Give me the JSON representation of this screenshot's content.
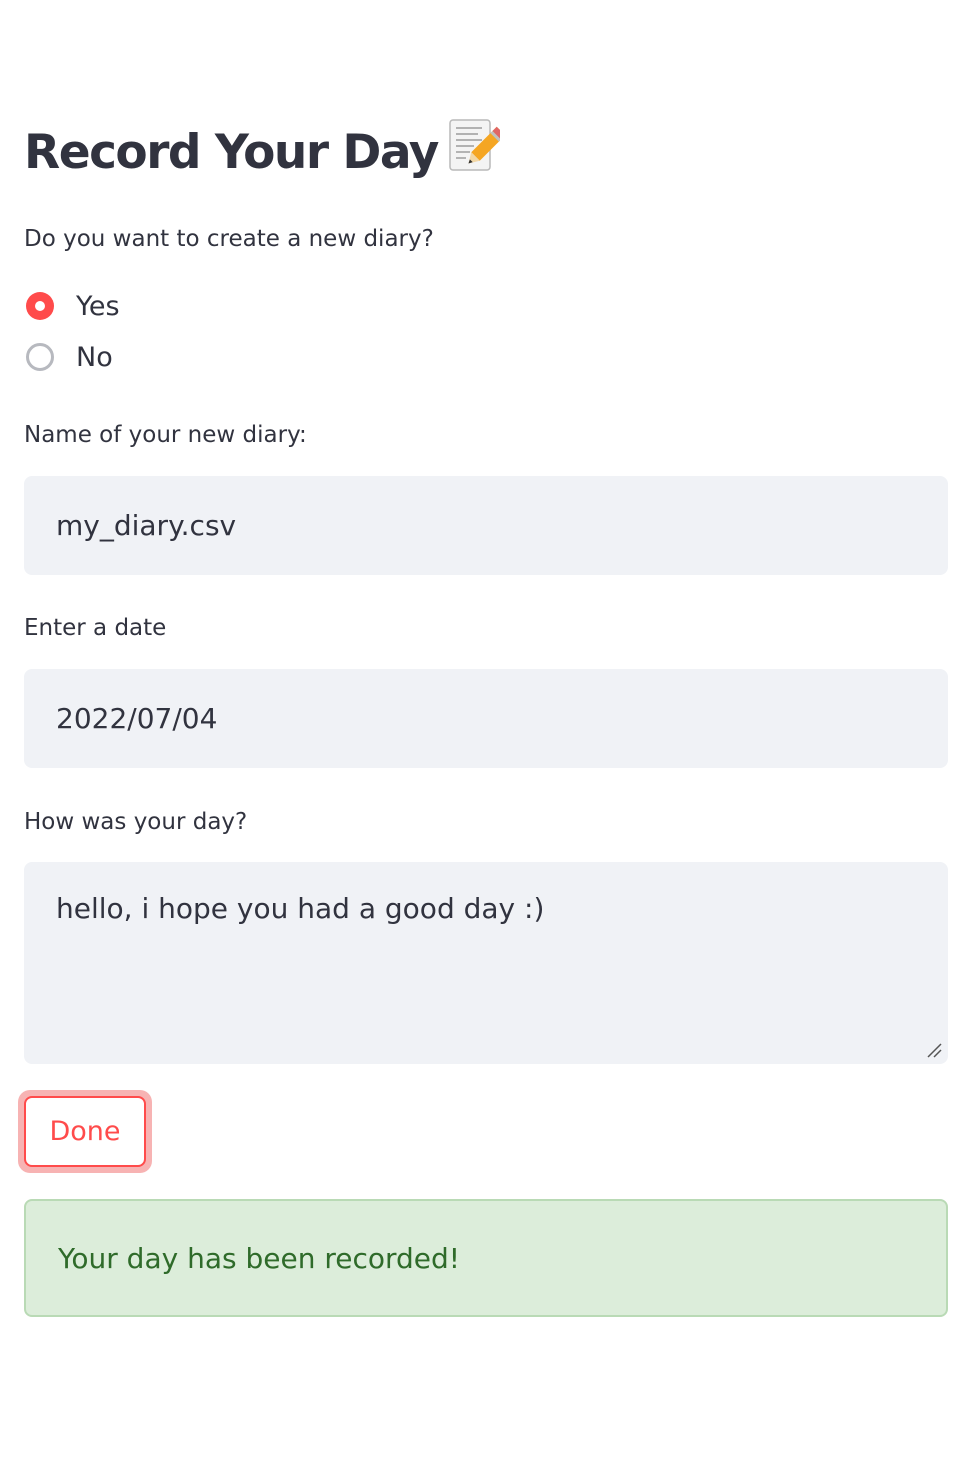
{
  "page": {
    "title": "Record Your Day",
    "title_icon": "memo-pencil-icon"
  },
  "create_new": {
    "question": "Do you want to create a new diary?",
    "options": [
      {
        "label": "Yes",
        "selected": true
      },
      {
        "label": "No",
        "selected": false
      }
    ]
  },
  "diary_name": {
    "label": "Name of your new diary:",
    "value": "my_diary.csv"
  },
  "date": {
    "label": "Enter a date",
    "value": "2022/07/04"
  },
  "day_entry": {
    "label": "How was your day?",
    "value": "hello, i hope you had a good day :)"
  },
  "actions": {
    "done_label": "Done"
  },
  "status": {
    "success_message": "Your day has been recorded!"
  },
  "colors": {
    "accent": "#ff4b4b",
    "input_background": "#f0f2f6",
    "text": "#31333f",
    "success_background": "#dcedda",
    "success_text": "#2f6b2a"
  }
}
